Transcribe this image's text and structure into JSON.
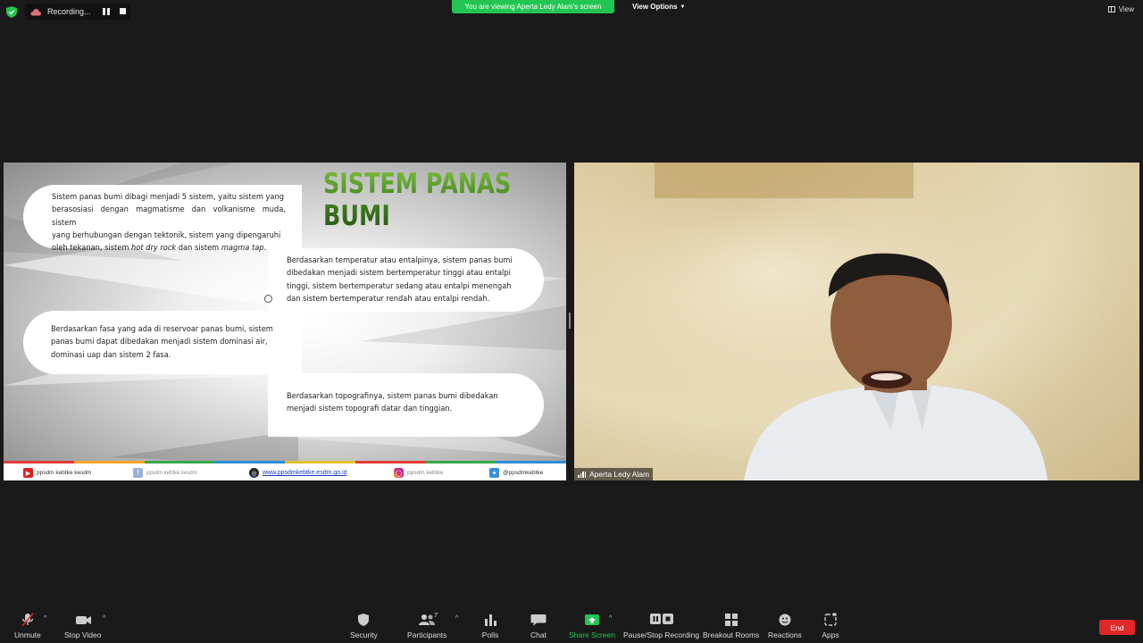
{
  "topbar": {
    "recording_text": "Recording...",
    "viewing_banner": "You are viewing Aperta Ledy Alam's screen",
    "view_options": "View Options",
    "view_label": "View"
  },
  "slide": {
    "title": "SISTEM PANAS BUMI",
    "b1": [
      "Sistem panas bumi dibagi menjadi 5 sistem, yaitu sistem yang",
      "berasosiasi dengan magmatisme dan volkanisme muda, sistem",
      "yang berhubungan dengan tektonik, sistem yang dipengaruhi",
      "oleh tekanan, sistem hot dry rock dan sistem magma tap."
    ],
    "b2": [
      "Berdasarkan temperatur atau entalpinya, sistem panas bumi",
      "dibedakan menjadi sistem bertemperatur tinggi atau entalpi",
      "tinggi, sistem bertemperatur sedang atau entalpi menengah",
      "dan sistem bertemperatur rendah atau entalpi rendah."
    ],
    "b3": [
      "Berdasarkan fasa yang ada di reservoar panas bumi, sistem",
      "panas bumi dapat dibedakan menjadi sistem dominasi air,",
      "dominasi uap dan sistem 2 fasa."
    ],
    "b4": [
      "Berdasarkan topografinya, sistem panas bumi dibedakan",
      "menjadi sistem topografi datar dan tinggian."
    ],
    "footer": {
      "youtube": "ppsdm kebtke kesdm",
      "facebook": "ppsdm kebtke kesdm",
      "website": "www.ppsdmkebtke.esdm.go.id",
      "instagram": "ppsdm kebtke",
      "twitter": "@ppsdmkebtke"
    },
    "strip_colors": [
      "#e23b3b",
      "#f2a62c",
      "#3aa64b",
      "#2c8fd6",
      "#e2c12c",
      "#e23b3b",
      "#3aa64b",
      "#2c8fd6"
    ]
  },
  "camera": {
    "participant_name": "Aperta Ledy Alam"
  },
  "toolbar": {
    "unmute": "Unmute",
    "stop_video": "Stop Video",
    "security": "Security",
    "participants": "Participants",
    "participants_count": "7",
    "polls": "Polls",
    "chat": "Chat",
    "share_screen": "Share Screen",
    "pause_recording": "Pause/Stop Recording",
    "breakout_rooms": "Breakout Rooms",
    "reactions": "Reactions",
    "apps": "Apps",
    "end": "End"
  },
  "colors": {
    "zoom_green": "#23c552",
    "end_red": "#e02828",
    "background": "#1a1a1a"
  }
}
